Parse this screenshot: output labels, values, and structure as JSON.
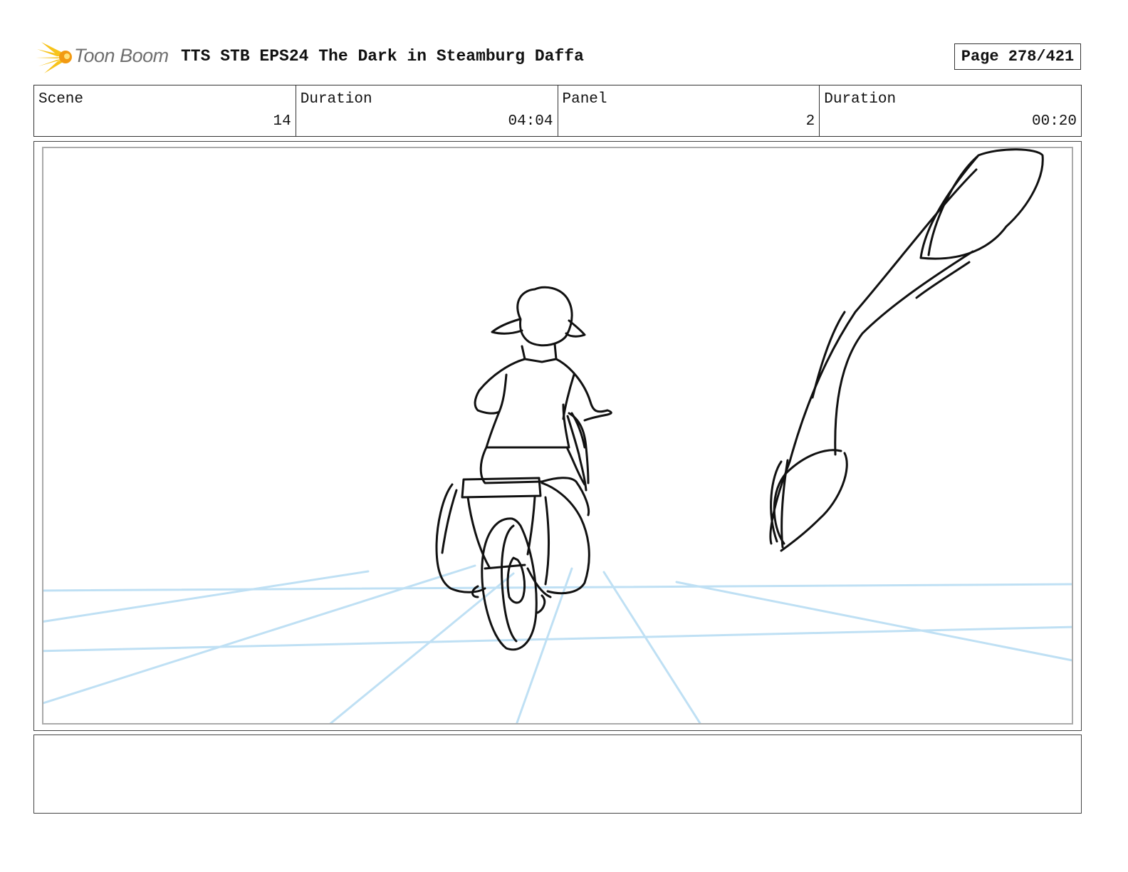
{
  "header": {
    "logo_text": "Toon Boom",
    "logo_icon": "starburst-icon",
    "title": "TTS STB EPS24 The Dark in Steamburg Daffa",
    "page_label": "Page 278/421"
  },
  "info": {
    "scene_label": "Scene",
    "scene_value": "14",
    "scene_duration_label": "Duration",
    "scene_duration_value": "04:04",
    "panel_label": "Panel",
    "panel_value": "2",
    "panel_duration_label": "Duration",
    "panel_duration_value": "00:20"
  },
  "panel": {
    "image_alt": "sketch-child-riding-bike-toward-giant-pipe",
    "guide_line_color": "#bfe0f4",
    "sketch_color": "#111111"
  },
  "notes": {
    "text": ""
  },
  "colors": {
    "logo_yellow": "#f7c31a",
    "logo_orange": "#f29a12",
    "logo_text": "#6f6f6f",
    "border": "#333333"
  }
}
